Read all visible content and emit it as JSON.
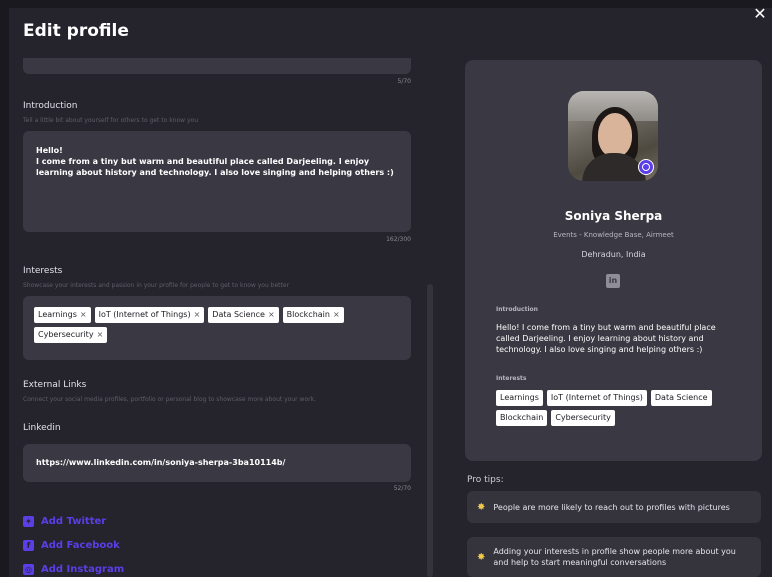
{
  "modal": {
    "title": "Edit profile",
    "close_icon": "✕"
  },
  "form": {
    "top_counter": "5/70",
    "introduction": {
      "label": "Introduction",
      "help": "Tell a little bit about yourself for others to get to know you",
      "value": "Hello!\nI come from a tiny but warm and beautiful place called Darjeeling. I enjoy learning about history and technology. I also love singing and helping others :)",
      "counter": "162/300"
    },
    "interests": {
      "label": "Interests",
      "help": "Showcase your interests and passion in your profile for people to get to know you better",
      "chips": [
        "Learnings",
        "IoT (Internet of Things)",
        "Data Science",
        "Blockchain",
        "Cybersecurity"
      ],
      "remove_glyph": "×"
    },
    "external_links": {
      "label": "External Links",
      "help": "Connect your social media profiles, portfolio or personal blog to showcase more about your work."
    },
    "linkedin": {
      "label": "Linkedin",
      "value": "https://www.linkedin.com/in/soniya-sherpa-3ba10114b/",
      "counter": "52/70"
    },
    "social_links": [
      {
        "label": "Add Twitter",
        "icon": "twitter-icon",
        "glyph": "✦"
      },
      {
        "label": "Add Facebook",
        "icon": "facebook-icon",
        "glyph": "f"
      },
      {
        "label": "Add Instagram",
        "icon": "instagram-icon",
        "glyph": "◎"
      }
    ]
  },
  "profile_card": {
    "name": "Soniya Sherpa",
    "role": "Events - Knowledge Base, Airmeet",
    "location": "Dehradun, India",
    "linkedin_glyph": "in",
    "intro_heading": "Introduction",
    "intro_text": "Hello! I come from a tiny but warm and beautiful place called Darjeeling. I enjoy learning about history and technology. I also love singing and helping others :)",
    "interests_heading": "Interests",
    "chips": [
      "Learnings",
      "IoT (Internet of Things)",
      "Data Science",
      "Blockchain",
      "Cybersecurity"
    ]
  },
  "pro_tips": {
    "title": "Pro tips:",
    "star_glyph": "✸",
    "items": [
      "People are more likely to reach out to profiles with pictures",
      "Adding your interests in profile show people more about you and help to start meaningful conversations"
    ]
  },
  "colors": {
    "accent": "#5b3ee8",
    "background": "#25232b",
    "input_bg": "#3a3842"
  }
}
